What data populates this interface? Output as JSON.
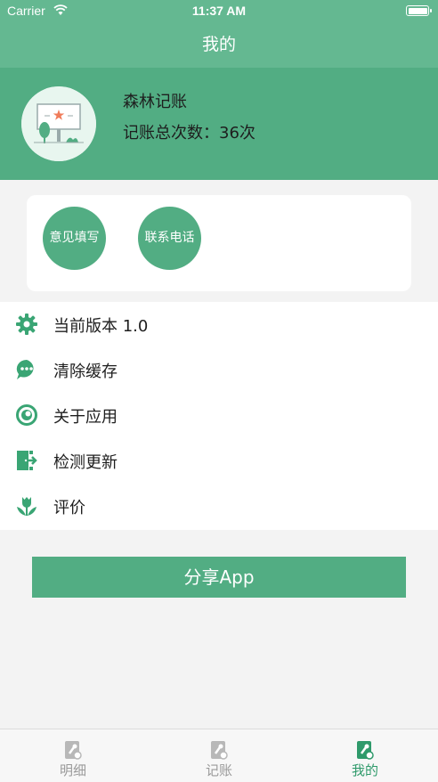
{
  "status_bar": {
    "carrier": "Carrier",
    "time": "11:37 AM"
  },
  "nav": {
    "title": "我的"
  },
  "profile": {
    "name": "森林记账",
    "count_text": "记账总次数：36次"
  },
  "actions": {
    "feedback": "意见填写",
    "contact": "联系电话"
  },
  "menu": {
    "items": [
      {
        "label": "当前版本 1.0",
        "icon": "gear-icon"
      },
      {
        "label": "清除缓存",
        "icon": "chat-bubble-icon"
      },
      {
        "label": "关于应用",
        "icon": "ring-icon"
      },
      {
        "label": "检测更新",
        "icon": "exit-door-icon"
      },
      {
        "label": "评价",
        "icon": "tulip-icon"
      }
    ]
  },
  "share_button": {
    "label": "分享App"
  },
  "tabs": [
    {
      "label": "明细",
      "active": false
    },
    {
      "label": "记账",
      "active": false
    },
    {
      "label": "我的",
      "active": true
    }
  ],
  "colors": {
    "primary": "#52ad83",
    "header": "#64b891",
    "active_tab": "#2f9a6b",
    "inactive_tab": "#9a9a9a",
    "background": "#f3f3f3"
  }
}
